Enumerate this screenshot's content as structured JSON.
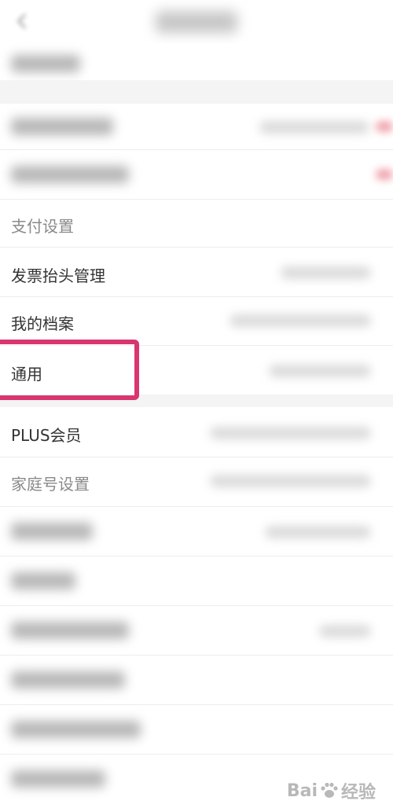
{
  "rows": {
    "payment": "支付设置",
    "invoice": "发票抬头管理",
    "profile": "我的档案",
    "general": "通用",
    "plus": "PLUS会员",
    "family": "家庭号设置"
  },
  "watermark": {
    "brand_left": "Bai",
    "brand_right": "经验"
  },
  "colors": {
    "highlight_border": "#d9366f",
    "background": "#ffffff",
    "section_gap": "#f4f4f4",
    "label_text": "#333333"
  }
}
